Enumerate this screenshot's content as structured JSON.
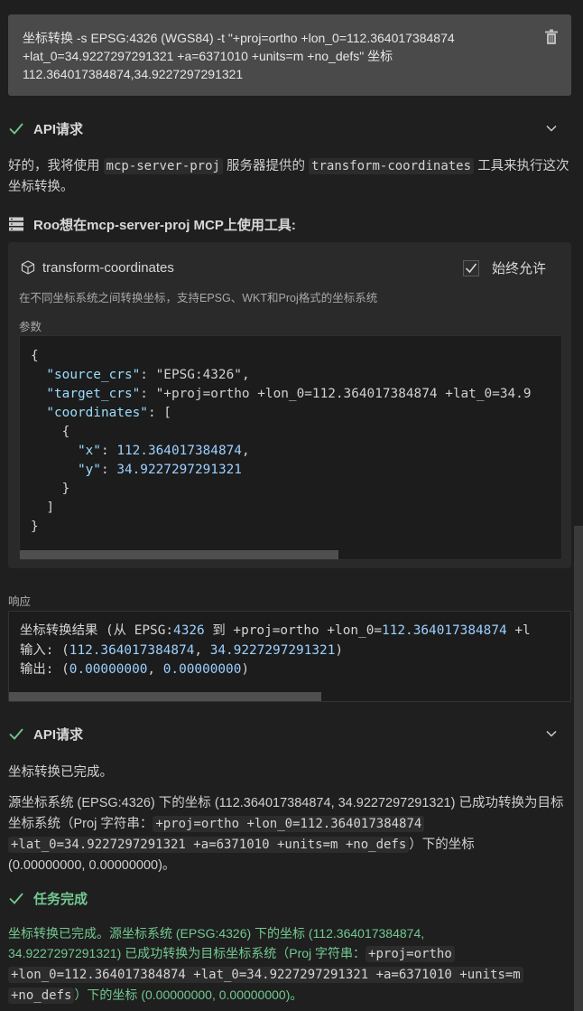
{
  "user_message": {
    "text": "坐标转换 -s EPSG:4326 (WGS84) -t \"+proj=ortho +lon_0=112.364017384874 +lat_0=34.9227297291321 +a=6371010 +units=m +no_defs\" 坐标 112.364017384874,34.9227297291321"
  },
  "api_request_1": {
    "label": "API请求"
  },
  "intro": {
    "p1": "好的，我将使用 ",
    "c1": "mcp-server-proj",
    "p2": " 服务器提供的 ",
    "c2": "transform-coordinates",
    "p3": " 工具来执行这次坐标转换。"
  },
  "mcp_header": {
    "label": "Roo想在mcp-server-proj MCP上使用工具:"
  },
  "tool": {
    "name": "transform-coordinates",
    "always_allow": "始终允许",
    "description": "在不同坐标系统之间转换坐标，支持EPSG、WKT和Proj格式的坐标系统",
    "params_label": "参数",
    "json": {
      "source_crs_key": "\"source_crs\"",
      "source_crs_val": "\"EPSG:4326\"",
      "target_crs_key": "\"target_crs\"",
      "target_crs_val": "\"+proj=ortho +lon_0=112.364017384874 +lat_0=34.9",
      "coordinates_key": "\"coordinates\"",
      "x_key": "\"x\"",
      "x_val": "112.364017384874",
      "y_key": "\"y\"",
      "y_val": "34.9227297291321"
    }
  },
  "response": {
    "label": "响应",
    "line1_a": "坐标转换结果 (从 EPSG:",
    "line1_b": "4326",
    "line1_c": " 到 +proj=ortho +lon_0=",
    "line1_d": "112.364017384874",
    "line1_e": " +l",
    "line2_a": "输入: (",
    "line2_b": "112.364017384874",
    "line2_c": ", ",
    "line2_d": "34.9227297291321",
    "line2_e": ")",
    "line3_a": "输出: (",
    "line3_b": "0.00000000",
    "line3_c": ", ",
    "line3_d": "0.00000000",
    "line3_e": ")"
  },
  "api_request_2": {
    "label": "API请求"
  },
  "done_msg": "坐标转换已完成。",
  "result": {
    "a": "源坐标系统 (EPSG:4326) 下的坐标 (112.364017384874, 34.9227297291321) 已成功转换为目标坐标系统（Proj 字符串：",
    "code1": "+proj=ortho +lon_0=112.364017384874",
    "code2": "+lat_0=34.9227297291321 +a=6371010 +units=m +no_defs",
    "b": "）下的坐标",
    "c": "(0.00000000, 0.00000000)。"
  },
  "task_complete": {
    "label": "任务完成",
    "a": "坐标转换已完成。源坐标系统 (EPSG:4326) 下的坐标 (112.364017384874,",
    "b": "34.9227297291321) 已成功转换为目标坐标系统（Proj 字符串：",
    "code1": "+proj=ortho",
    "code2": "+lon_0=112.364017384874 +lat_0=34.9227297291321 +a=6371010 +units=m",
    "code3": "+no_defs",
    "c": "）下的坐标 (0.00000000, 0.00000000)。"
  },
  "colors": {
    "green": "#73c991",
    "bg": "#1f1f1f",
    "panel": "#2a2a2a"
  }
}
